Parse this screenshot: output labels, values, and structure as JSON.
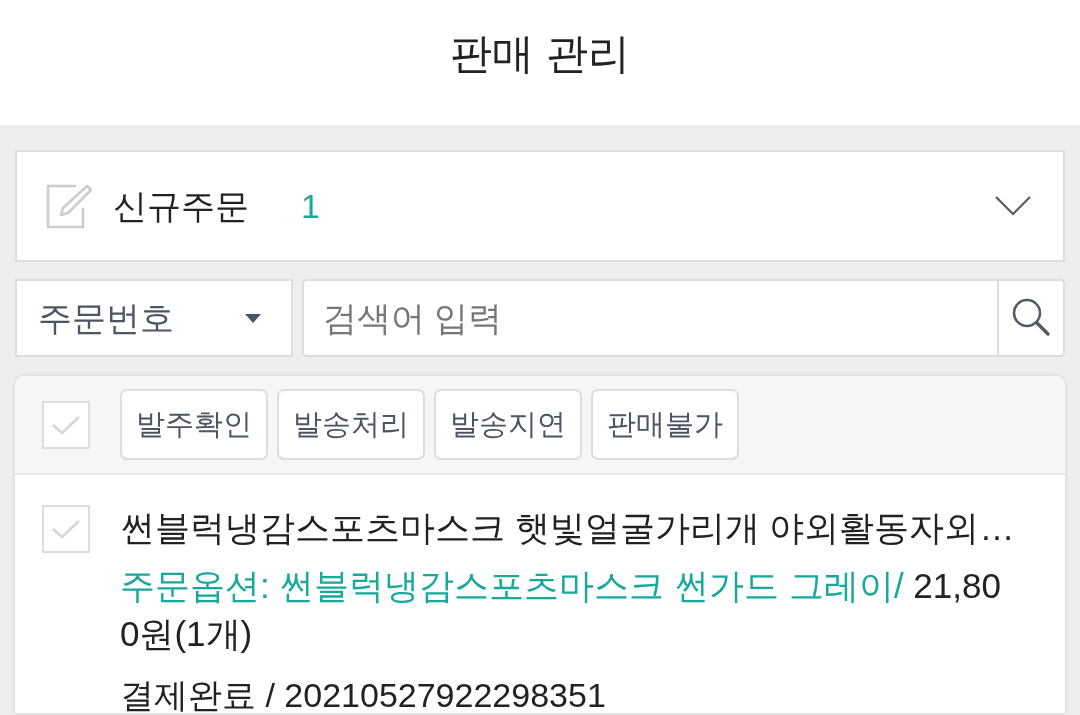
{
  "header": {
    "title": "판매 관리"
  },
  "order_filter": {
    "label": "신규주문",
    "count": "1",
    "expanded": false
  },
  "search": {
    "field_select": "주문번호",
    "placeholder": "검색어 입력"
  },
  "bulk_actions": {
    "select_all_checked": false,
    "buttons": [
      "발주확인",
      "발송처리",
      "발송지연",
      "판매불가"
    ]
  },
  "orders": [
    {
      "checked": false,
      "product_name": "썬블럭냉감스포츠마스크 햇빛얼굴가리개 야외활동자외…",
      "option": "주문옵션: 썬블럭냉감스포츠마스크 썬가드 그레이/",
      "price": "21,800원(1개)",
      "status_line": "결제완료 / 20210527922298351"
    }
  ]
}
